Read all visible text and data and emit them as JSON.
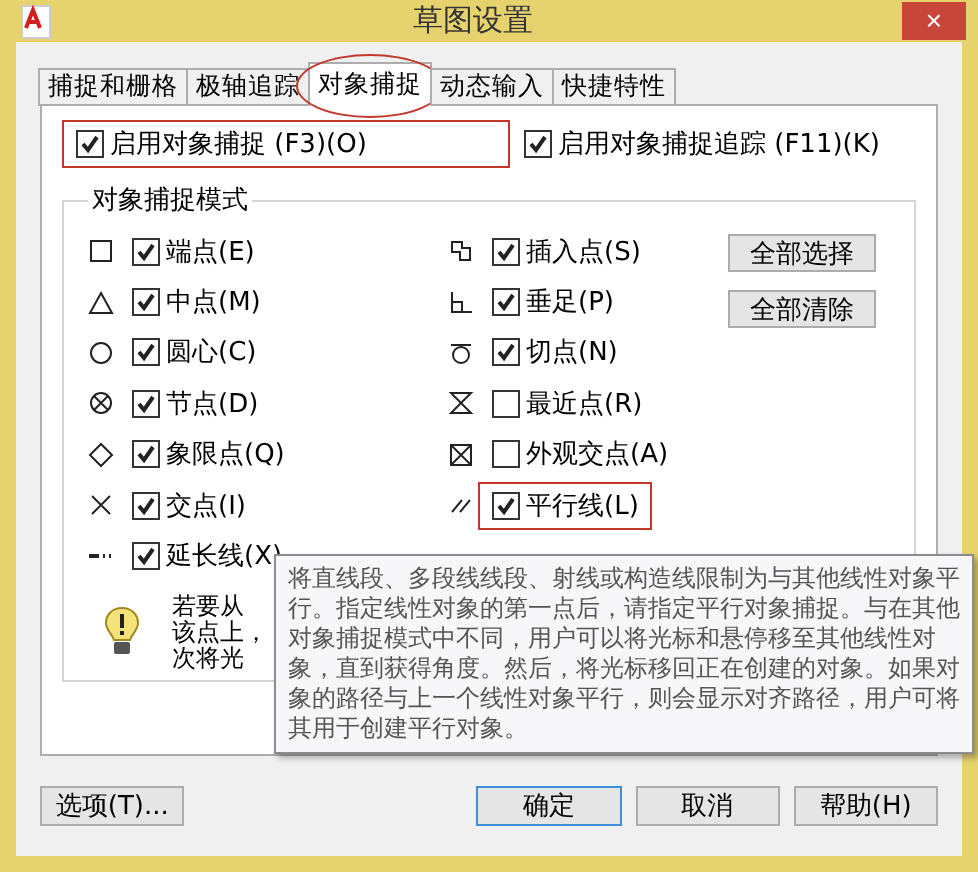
{
  "window": {
    "title": "草图设置",
    "close": "×"
  },
  "tabs": [
    {
      "label": "捕捉和栅格",
      "selected": false,
      "circled": false
    },
    {
      "label": "极轴追踪",
      "selected": false,
      "circled": false
    },
    {
      "label": "对象捕捉",
      "selected": true,
      "circled": true
    },
    {
      "label": "动态输入",
      "selected": false,
      "circled": false
    },
    {
      "label": "快捷特性",
      "selected": false,
      "circled": false
    }
  ],
  "enable_snap": {
    "label": "启用对象捕捉 (F3)(O)",
    "checked": true,
    "boxed": true
  },
  "enable_tracking": {
    "label": "启用对象捕捉追踪 (F11)(K)",
    "checked": true,
    "boxed": false
  },
  "modes_group": {
    "title": "对象捕捉模式",
    "left": [
      {
        "kind": "endpoint",
        "label": "端点(E)",
        "checked": true,
        "boxed": false
      },
      {
        "kind": "midpoint",
        "label": "中点(M)",
        "checked": true,
        "boxed": false
      },
      {
        "kind": "center",
        "label": "圆心(C)",
        "checked": true,
        "boxed": false
      },
      {
        "kind": "node",
        "label": "节点(D)",
        "checked": true,
        "boxed": false
      },
      {
        "kind": "quadrant",
        "label": "象限点(Q)",
        "checked": true,
        "boxed": false
      },
      {
        "kind": "intersection",
        "label": "交点(I)",
        "checked": true,
        "boxed": false
      },
      {
        "kind": "extension",
        "label": "延长线(X)",
        "checked": true,
        "boxed": false
      }
    ],
    "right": [
      {
        "kind": "insertion",
        "label": "插入点(S)",
        "checked": true,
        "boxed": false
      },
      {
        "kind": "perpendicular",
        "label": "垂足(P)",
        "checked": true,
        "boxed": false
      },
      {
        "kind": "tangent",
        "label": "切点(N)",
        "checked": true,
        "boxed": false
      },
      {
        "kind": "nearest",
        "label": "最近点(R)",
        "checked": false,
        "boxed": false
      },
      {
        "kind": "apparent",
        "label": "外观交点(A)",
        "checked": false,
        "boxed": false
      },
      {
        "kind": "parallel",
        "label": "平行线(L)",
        "checked": true,
        "boxed": true
      }
    ],
    "buttons": [
      "全部选择",
      "全部清除"
    ],
    "hint_lines": [
      "若要从",
      "该点上，",
      "次将光"
    ]
  },
  "tooltip": "将直线段、多段线线段、射线或构造线限制为与其他线性对象平行。指定线性对象的第一点后，请指定平行对象捕捉。与在其他对象捕捉模式中不同，用户可以将光标和悬停移至其他线性对象，直到获得角度。然后，将光标移回正在创建的对象。如果对象的路径与上一个线性对象平行，则会显示对齐路径，用户可将其用于创建平行对象。",
  "footer": {
    "options": "选项(T)...",
    "buttons": [
      {
        "label": "确定",
        "default": true
      },
      {
        "label": "取消",
        "default": false
      },
      {
        "label": "帮助(H)",
        "default": false
      }
    ]
  }
}
